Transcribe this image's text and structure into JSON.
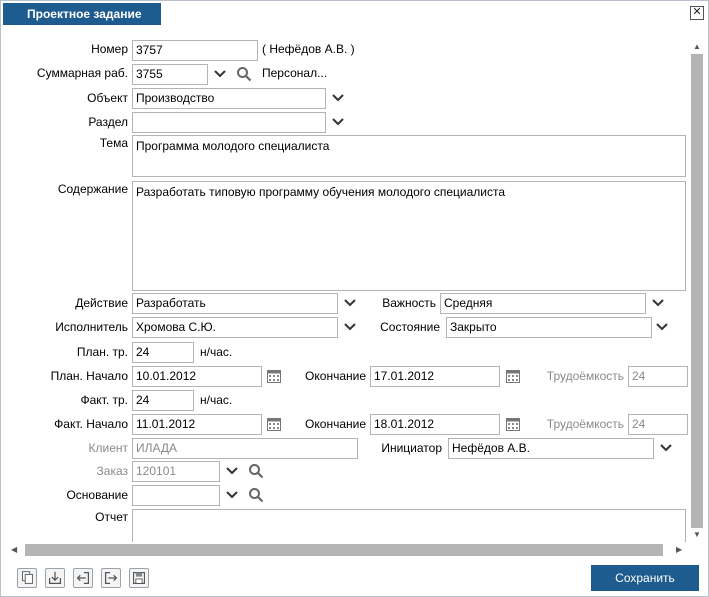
{
  "window": {
    "title": "Проектное задание",
    "close_glyph": "✕"
  },
  "fields": {
    "nomer": {
      "label": "Номер",
      "value": "3757",
      "author": "( Нефёдов А.В. )"
    },
    "summary": {
      "label": "Суммарная раб.",
      "value": "3755",
      "link": "Персонал..."
    },
    "object": {
      "label": "Объект",
      "value": "Производство"
    },
    "section": {
      "label": "Раздел",
      "value": ""
    },
    "theme": {
      "label": "Тема",
      "value": "Программа молодого специалиста"
    },
    "content": {
      "label": "Содержание",
      "value": "Разработать типовую программу обучения молодого специалиста"
    },
    "action": {
      "label": "Действие",
      "value": "Разработать"
    },
    "importance": {
      "label": "Важность",
      "value": "Средняя"
    },
    "executor": {
      "label": "Исполнитель",
      "value": "Хромова С.Ю."
    },
    "state": {
      "label": "Состояние",
      "value": "Закрыто"
    },
    "plan_hours": {
      "label": "План. тр.",
      "value": "24",
      "unit": "н/час."
    },
    "plan_start": {
      "label": "План. Начало",
      "value": "10.01.2012"
    },
    "plan_end": {
      "label": "Окончание",
      "value": "17.01.2012"
    },
    "plan_labor": {
      "label": "Трудоёмкость",
      "value": "24"
    },
    "fact_hours": {
      "label": "Факт. тр.",
      "value": "24",
      "unit": "н/час."
    },
    "fact_start": {
      "label": "Факт. Начало",
      "value": "11.01.2012"
    },
    "fact_end": {
      "label": "Окончание",
      "value": "18.01.2012"
    },
    "fact_labor": {
      "label": "Трудоёмкость",
      "value": "24"
    },
    "client": {
      "label": "Клиент",
      "value": "ИЛАДА"
    },
    "initiator": {
      "label": "Инициатор",
      "value": "Нефёдов А.В."
    },
    "order": {
      "label": "Заказ",
      "value": "120101"
    },
    "basis": {
      "label": "Основание",
      "value": ""
    },
    "report": {
      "label": "Отчет",
      "value": ""
    }
  },
  "footer": {
    "save_label": "Сохранить"
  },
  "colors": {
    "accent": "#1e5b8f",
    "border": "#b4b4b4",
    "disabled_text": "#8a8a8a",
    "scrollbar": "#b4b4b4"
  },
  "icons": [
    "chevron-down-icon",
    "search-icon",
    "calendar-icon",
    "copy-icon",
    "import-icon",
    "back-icon",
    "forward-icon",
    "save-disk-icon"
  ]
}
